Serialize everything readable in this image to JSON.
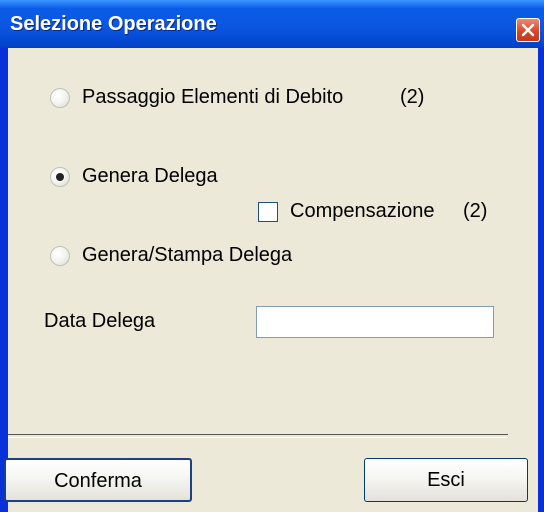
{
  "window": {
    "title": "Selezione Operazione",
    "title_color": "#ffffff",
    "frame_color": "#0831d9",
    "client_bg": "#ece9d8"
  },
  "options": [
    {
      "label": "Passaggio Elementi di Debito",
      "note": "(2)",
      "selected": false
    },
    {
      "label": "Genera Delega",
      "note": "",
      "selected": true
    },
    {
      "label": "Genera/Stampa Delega",
      "note": "",
      "selected": false
    }
  ],
  "compensazione": {
    "label": "Compensazione",
    "note": "(2)",
    "checked": false
  },
  "data_delega": {
    "label": "Data Delega",
    "value": ""
  },
  "buttons": {
    "confirm": "Conferma",
    "exit": "Esci"
  },
  "icons": {
    "close": "close-x-icon"
  }
}
